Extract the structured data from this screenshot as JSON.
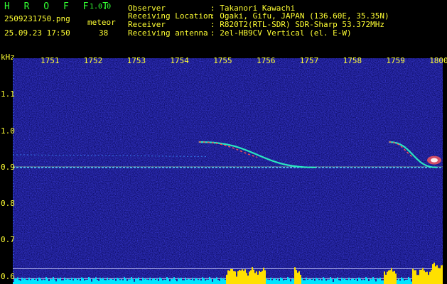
{
  "app": {
    "name": "H R O F F T",
    "version": "1.0.0"
  },
  "file": {
    "filename": "2509231750.png",
    "datetime": "25.09.23 17:50"
  },
  "meteor": {
    "label": "meteor",
    "count": "38"
  },
  "station": {
    "observer_label": "Observer",
    "observer_value": ": Takanori Kawachi",
    "location_label": "Receiving Location",
    "location_value": ": Ogaki, Gifu, JAPAN (136.60E, 35.35N)",
    "receiver_label": "Receiver",
    "receiver_value": ": R820T2(RTL-SDR) SDR-Sharp 53.372MHz",
    "antenna_label": "Receiving antenna",
    "antenna_value": ": 2el-HB9CV Vertical (el. E-W)"
  },
  "colors": {
    "text": "#ffff33",
    "title": "#33ff33",
    "background": "#000000",
    "noise": "#16168a"
  },
  "chart_data": {
    "type": "heatmap",
    "y_unit": "kHz",
    "x_ticks": [
      "1751",
      "1752",
      "1753",
      "1754",
      "1755",
      "1756",
      "1757",
      "1758",
      "1759",
      "1800"
    ],
    "y_ticks": [
      "1.1",
      "1.0",
      "0.9",
      "0.8",
      "0.7",
      "0.6"
    ],
    "ylim": [
      0.58,
      1.2
    ],
    "carrier_khz": 0.9,
    "echoes": [
      {
        "x_start": "1754.5",
        "x_end": "1757.2",
        "f_start": 0.97,
        "f_end": 0.9
      },
      {
        "x_start": "1758.9",
        "x_end": "1800",
        "f_start": 0.97,
        "f_end": 0.9
      }
    ],
    "grid": false
  }
}
